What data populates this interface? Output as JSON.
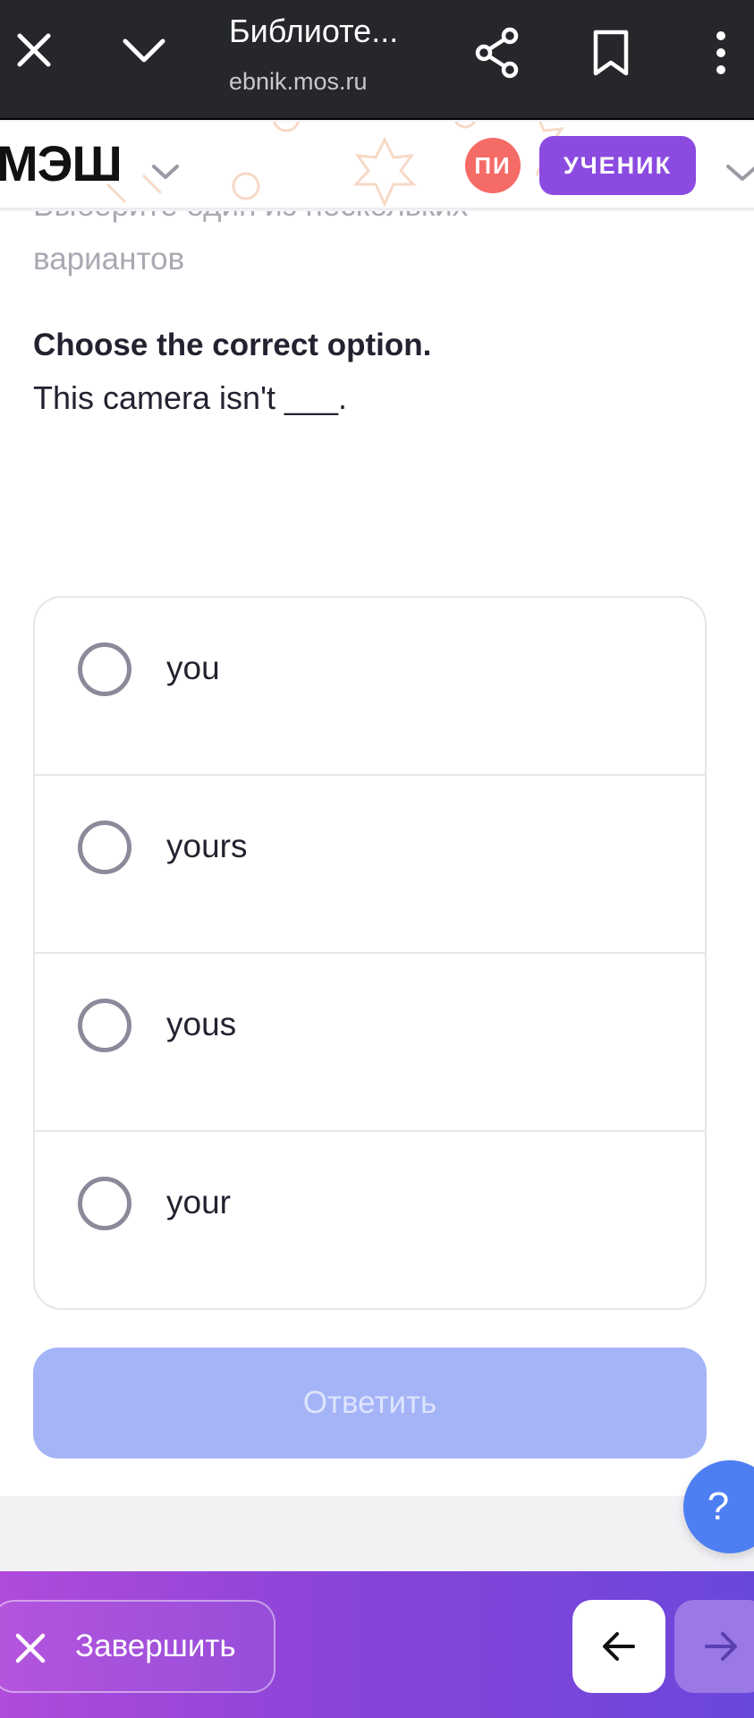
{
  "browser": {
    "title": "Библиоте...",
    "url": "ebnik.mos.ru",
    "icons": [
      "close-icon",
      "chevron-down-icon",
      "share-icon",
      "bookmark-icon",
      "more-vertical-icon"
    ]
  },
  "header": {
    "logo": "МЭШ",
    "avatar_initials": "ПИ",
    "role": "УЧЕНИК",
    "colors": {
      "avatar": "#f56b66",
      "role_badge": "#8b4be0"
    }
  },
  "task": {
    "instruction_line1": "Выберите один из нескольких",
    "instruction_line2": "вариантов",
    "question_title": "Choose the correct option.",
    "question_text": "This camera isn't ___."
  },
  "options": [
    {
      "label": "you",
      "selected": false
    },
    {
      "label": "yours",
      "selected": false
    },
    {
      "label": "yous",
      "selected": false
    },
    {
      "label": "your",
      "selected": false
    }
  ],
  "submit": {
    "label": "Ответить",
    "enabled": false,
    "color": "#a4b4f7"
  },
  "help": {
    "label": "?"
  },
  "footer": {
    "finish_label": "Завершить",
    "icons": [
      "close-icon",
      "arrow-left-icon",
      "arrow-right-icon"
    ]
  }
}
